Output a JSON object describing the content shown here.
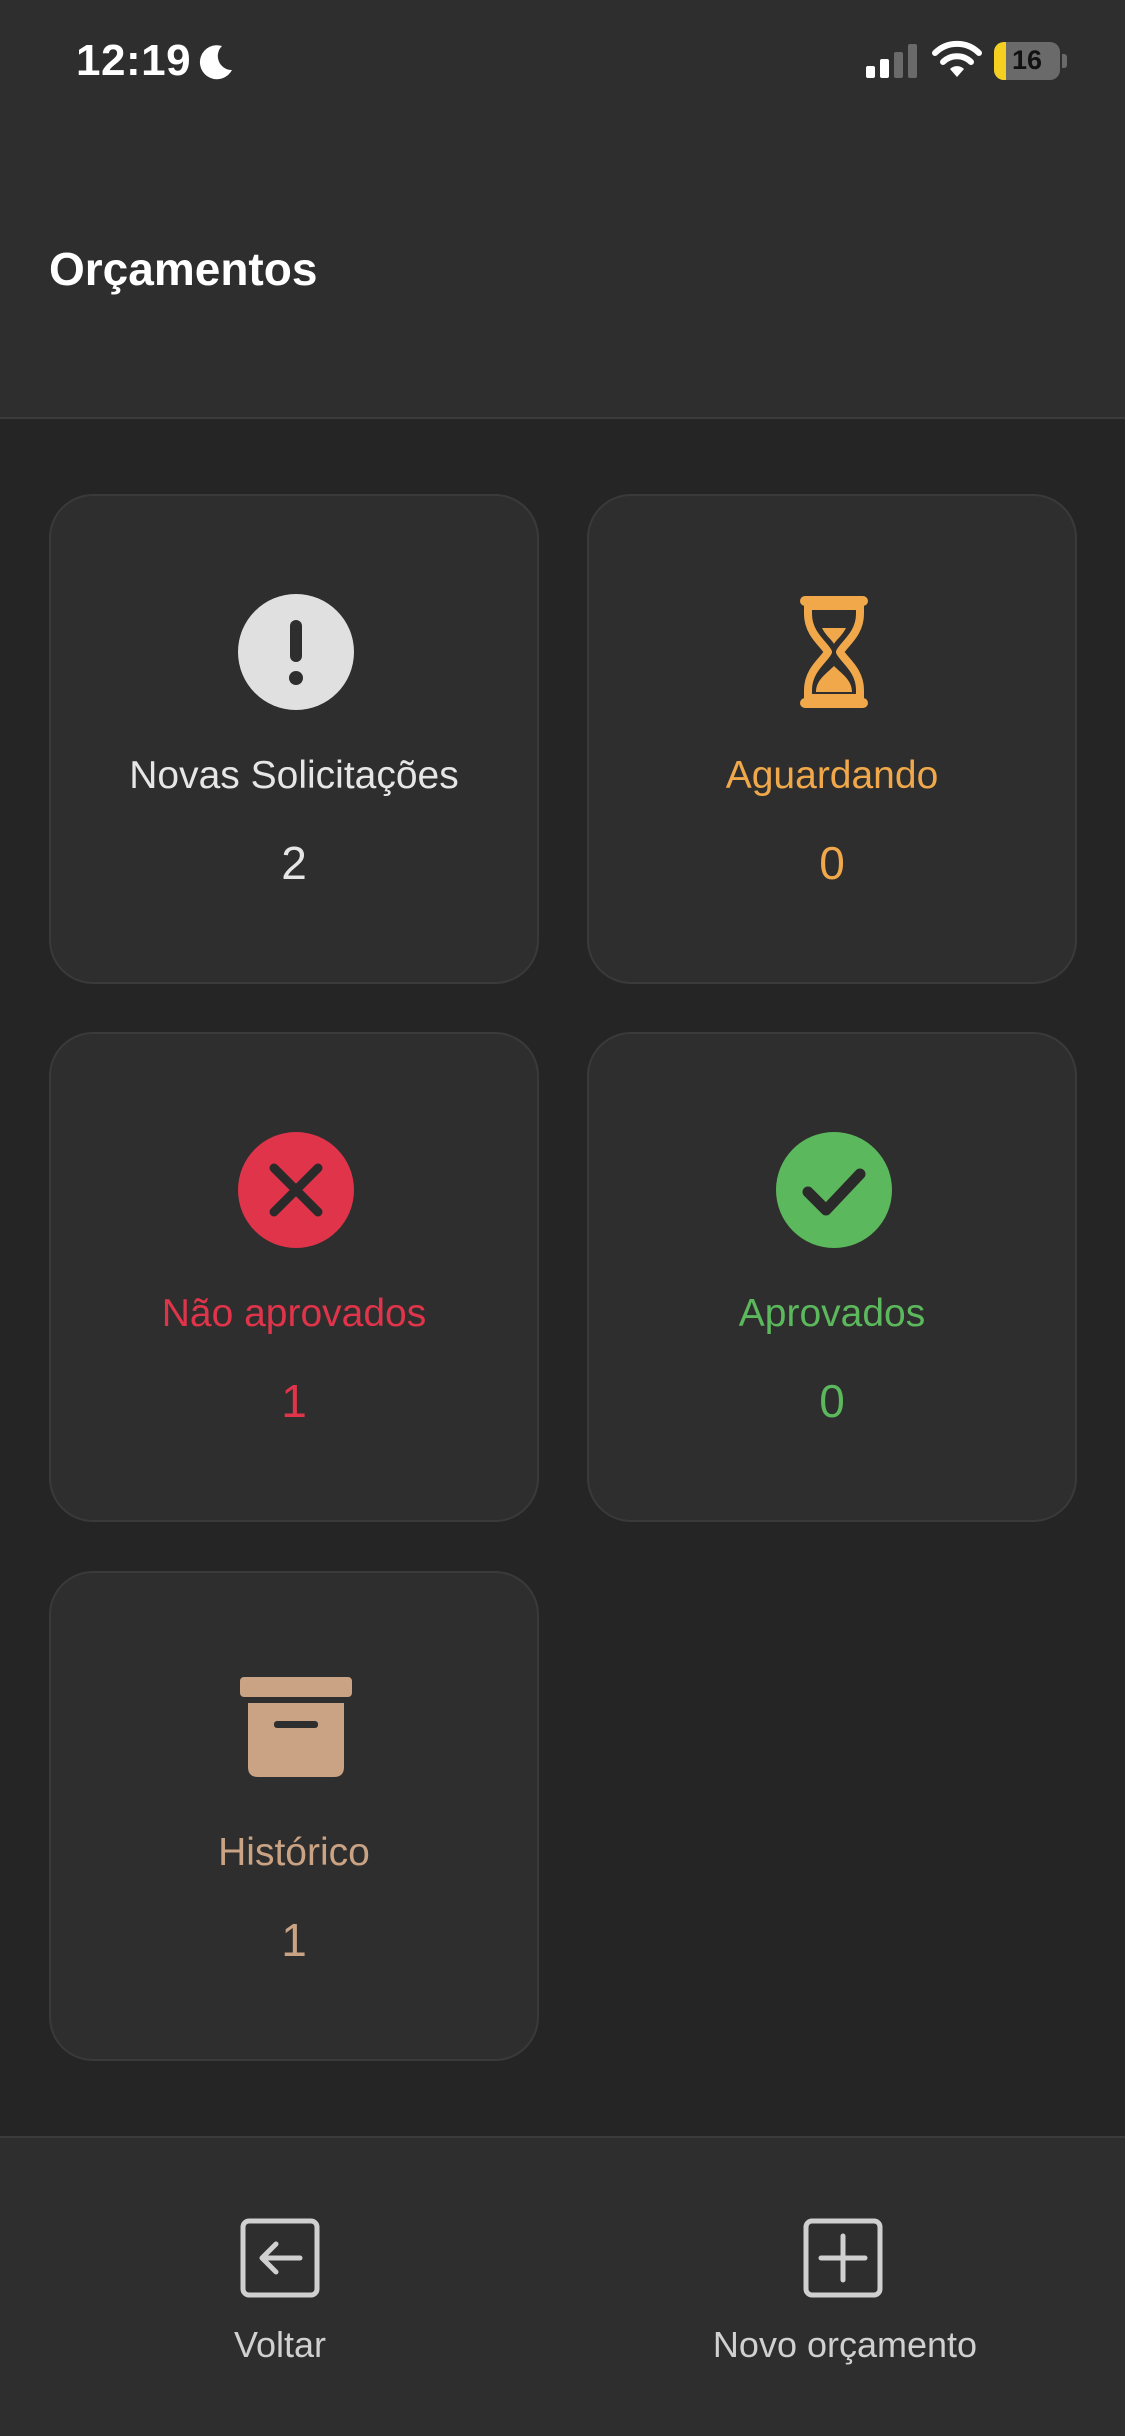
{
  "status_bar": {
    "time": "12:19",
    "battery_level": "16",
    "icons": [
      "moon-icon",
      "cellular-signal-icon",
      "wifi-icon",
      "battery-charging-icon"
    ]
  },
  "header": {
    "title": "Orçamentos"
  },
  "cards": {
    "new_requests": {
      "label": "Novas Solicitações",
      "count": "2",
      "icon": "exclamation-icon",
      "color": "#e6e6e6"
    },
    "waiting": {
      "label": "Aguardando",
      "count": "0",
      "icon": "hourglass-icon",
      "color": "#f0a84a"
    },
    "rejected": {
      "label": "Não aprovados",
      "count": "1",
      "icon": "x-circle-icon",
      "color": "#e0344a"
    },
    "approved": {
      "label": "Aprovados",
      "count": "0",
      "icon": "check-circle-icon",
      "color": "#5cb85c"
    },
    "history": {
      "label": "Histórico",
      "count": "1",
      "icon": "archive-box-icon",
      "color": "#c9a383"
    }
  },
  "bottom_bar": {
    "back_label": "Voltar",
    "new_label": "Novo orçamento"
  }
}
